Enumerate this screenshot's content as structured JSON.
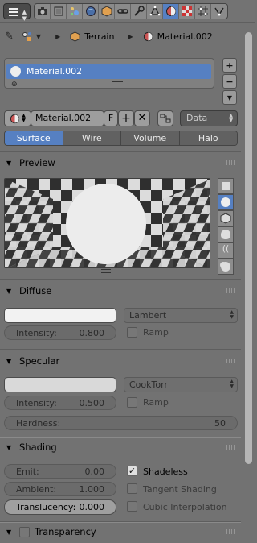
{
  "breadcrumb": {
    "object": "Terrain",
    "material": "Material.002"
  },
  "slot_list": {
    "selected": "Material.002"
  },
  "id_row": {
    "name": "Material.002",
    "fake_user": "F",
    "link_type": "Data"
  },
  "tabs": [
    "Surface",
    "Wire",
    "Volume",
    "Halo"
  ],
  "active_tab": "Surface",
  "preview": {
    "title": "Preview"
  },
  "diffuse": {
    "title": "Diffuse",
    "shader": "Lambert",
    "intensity_label": "Intensity:",
    "intensity_value": "0.800",
    "ramp_label": "Ramp"
  },
  "specular": {
    "title": "Specular",
    "shader": "CookTorr",
    "intensity_label": "Intensity:",
    "intensity_value": "0.500",
    "ramp_label": "Ramp",
    "hardness_label": "Hardness:",
    "hardness_value": "50"
  },
  "shading": {
    "title": "Shading",
    "emit_label": "Emit:",
    "emit_value": "0.00",
    "ambient_label": "Ambient:",
    "ambient_value": "1.000",
    "translucency_label": "Translucency:",
    "translucency_value": "0.000",
    "shadeless_label": "Shadeless",
    "shadeless_checked": true,
    "tangent_label": "Tangent Shading",
    "cubic_label": "Cubic Interpolation"
  },
  "transparency": {
    "title": "Transparency"
  },
  "colors": {
    "accent": "#5680c2",
    "panel_bg": "#727272"
  }
}
